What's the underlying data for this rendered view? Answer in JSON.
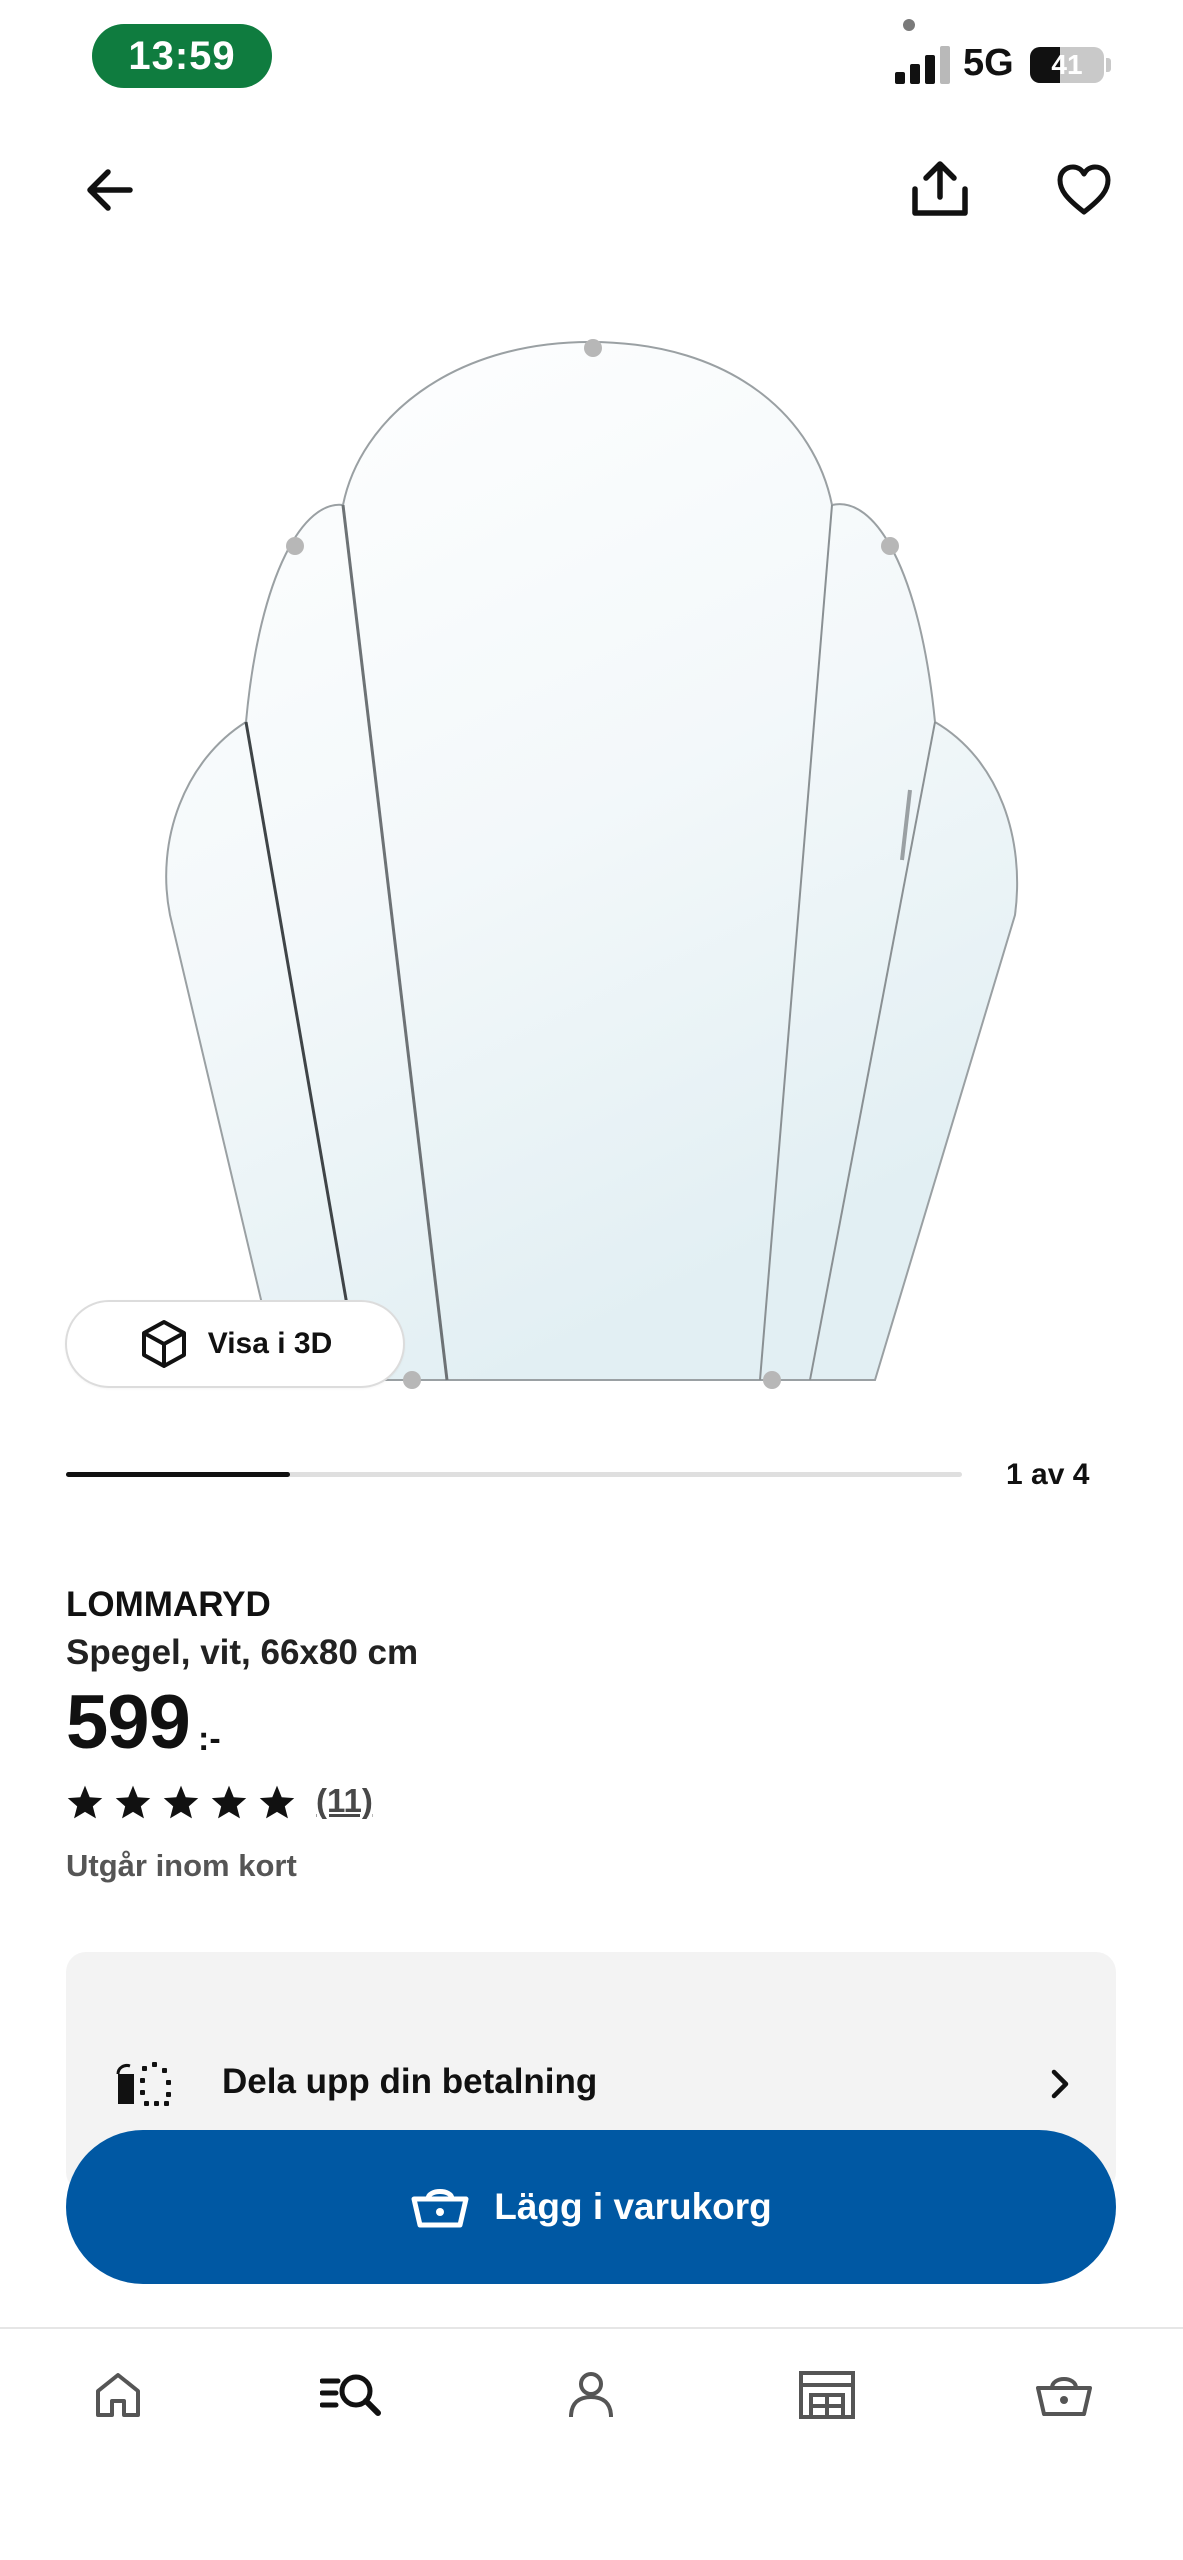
{
  "status_bar": {
    "time": "13:59",
    "network": "5G",
    "battery_level": "41",
    "battery_fraction": 0.41
  },
  "top_nav": {
    "back_icon": "arrow-left-icon",
    "share_icon": "share-icon",
    "favorite_icon": "heart-icon"
  },
  "product_image": {
    "icon": "mirror-image"
  },
  "view_3d": {
    "label": "Visa i 3D",
    "icon": "cube-icon"
  },
  "carousel": {
    "page_indicator": "1 av 4",
    "current": 1,
    "total": 4
  },
  "product": {
    "name": "LOMMARYD",
    "description": "Spegel, vit, 66x80 cm",
    "price": "599",
    "price_suffix": ":-",
    "rating": 5,
    "reviews": "(11)",
    "availability": "Utgår inom kort"
  },
  "payment": {
    "label": "Dela upp din betalning",
    "icon": "split-payment-icon",
    "chevron_icon": "chevron-right-icon"
  },
  "add_to_cart": {
    "label": "Lägg i varukorg",
    "icon": "basket-icon"
  },
  "bottom_nav": {
    "items": [
      {
        "icon": "home-icon"
      },
      {
        "icon": "search-list-icon"
      },
      {
        "icon": "profile-icon"
      },
      {
        "icon": "store-icon"
      },
      {
        "icon": "basket-icon"
      }
    ]
  },
  "colors": {
    "primary": "#0058a3",
    "status_green": "#0f7c3f",
    "card_bg": "#f3f3f3"
  }
}
